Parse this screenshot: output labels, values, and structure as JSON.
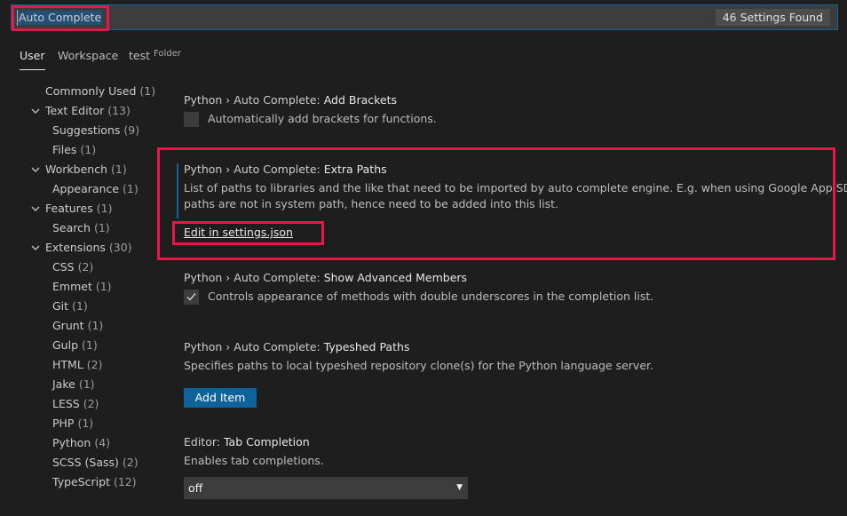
{
  "search": {
    "value": "Auto Complete",
    "count_badge": "46 Settings Found"
  },
  "tabs": [
    {
      "label": "User",
      "active": true
    },
    {
      "label": "Workspace",
      "active": false
    },
    {
      "label": "test",
      "suffix": "Folder",
      "active": false
    }
  ],
  "toc": [
    {
      "label": "Commonly Used",
      "count": "(1)",
      "level": 0,
      "expanded": null
    },
    {
      "label": "Text Editor",
      "count": "(13)",
      "level": 0,
      "expanded": true
    },
    {
      "label": "Suggestions",
      "count": "(9)",
      "level": 1,
      "expanded": null
    },
    {
      "label": "Files",
      "count": "(1)",
      "level": 1,
      "expanded": null
    },
    {
      "label": "Workbench",
      "count": "(1)",
      "level": 0,
      "expanded": true
    },
    {
      "label": "Appearance",
      "count": "(1)",
      "level": 1,
      "expanded": null
    },
    {
      "label": "Features",
      "count": "(1)",
      "level": 0,
      "expanded": true
    },
    {
      "label": "Search",
      "count": "(1)",
      "level": 1,
      "expanded": null
    },
    {
      "label": "Extensions",
      "count": "(30)",
      "level": 0,
      "expanded": true
    },
    {
      "label": "CSS",
      "count": "(2)",
      "level": 1,
      "expanded": null
    },
    {
      "label": "Emmet",
      "count": "(1)",
      "level": 1,
      "expanded": null
    },
    {
      "label": "Git",
      "count": "(1)",
      "level": 1,
      "expanded": null
    },
    {
      "label": "Grunt",
      "count": "(1)",
      "level": 1,
      "expanded": null
    },
    {
      "label": "Gulp",
      "count": "(1)",
      "level": 1,
      "expanded": null
    },
    {
      "label": "HTML",
      "count": "(2)",
      "level": 1,
      "expanded": null
    },
    {
      "label": "Jake",
      "count": "(1)",
      "level": 1,
      "expanded": null
    },
    {
      "label": "LESS",
      "count": "(2)",
      "level": 1,
      "expanded": null
    },
    {
      "label": "PHP",
      "count": "(1)",
      "level": 1,
      "expanded": null
    },
    {
      "label": "Python",
      "count": "(4)",
      "level": 1,
      "expanded": null
    },
    {
      "label": "SCSS (Sass)",
      "count": "(2)",
      "level": 1,
      "expanded": null
    },
    {
      "label": "TypeScript",
      "count": "(12)",
      "level": 1,
      "expanded": null
    }
  ],
  "settings": {
    "add_brackets": {
      "category": "Python › Auto Complete: ",
      "name": "Add Brackets",
      "description": "Automatically add brackets for functions.",
      "checked": false
    },
    "extra_paths": {
      "category": "Python › Auto Complete: ",
      "name": "Extra Paths",
      "description_line1": "List of paths to libraries and the like that need to be imported by auto complete engine. E.g. when using Google App SDK, the",
      "description_line2": "paths are not in system path, hence need to be added into this list.",
      "link": "Edit in settings.json"
    },
    "show_advanced": {
      "category": "Python › Auto Complete: ",
      "name": "Show Advanced Members",
      "description": "Controls appearance of methods with double underscores in the completion list.",
      "checked": true
    },
    "typeshed_paths": {
      "category": "Python › Auto Complete: ",
      "name": "Typeshed Paths",
      "description": "Specifies paths to local typeshed repository clone(s) for the Python language server.",
      "button": "Add Item"
    },
    "tab_completion": {
      "category": "Editor: ",
      "name": "Tab Completion",
      "description": "Enables tab completions.",
      "value": "off"
    }
  },
  "colors": {
    "background": "#1e1e1e",
    "highlight_red": "#e8174a",
    "accent_blue": "#0e639c"
  }
}
